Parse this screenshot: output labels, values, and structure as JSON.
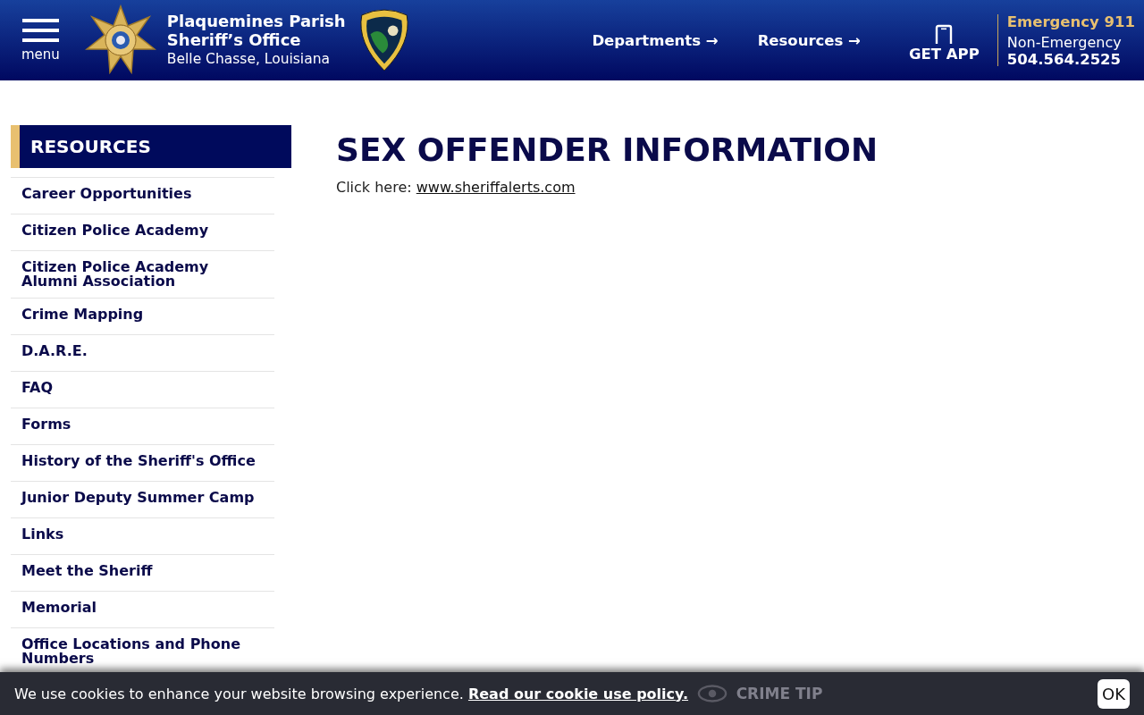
{
  "header": {
    "menu_label": "menu",
    "title_line1": "Plaquemines Parish",
    "title_line2": "Sheriff’s Office",
    "subtitle": "Belle Chasse, Louisiana",
    "nav": [
      {
        "label": "Departments",
        "arrow": "→"
      },
      {
        "label": "Resources",
        "arrow": "→"
      }
    ],
    "app_label": "GET APP",
    "emergency": "Emergency 911",
    "non_emergency_label": "Non-Emergency",
    "non_emergency_number": "504.564.2525"
  },
  "sidebar": {
    "heading": "RESOURCES",
    "items": [
      {
        "label": "Career Opportunities"
      },
      {
        "label": "Citizen Police Academy"
      },
      {
        "label": "Citizen Police Academy Alumni Association"
      },
      {
        "label": "Crime Mapping"
      },
      {
        "label": "D.A.R.E."
      },
      {
        "label": "FAQ"
      },
      {
        "label": "Forms"
      },
      {
        "label": "History of the Sheriff's Office"
      },
      {
        "label": "Junior Deputy Summer Camp"
      },
      {
        "label": "Links"
      },
      {
        "label": "Meet the Sheriff"
      },
      {
        "label": "Memorial"
      },
      {
        "label": "Office Locations and Phone Numbers"
      }
    ]
  },
  "main": {
    "title": "SEX OFFENDER INFORMATION",
    "lead": "Click here:",
    "link": "www.sheriffalerts.com"
  },
  "bottom_bar": {
    "crime_tip": "CRIME TIP"
  },
  "cookie_bar": {
    "text": "We use cookies to enhance your website browsing experience.",
    "link": "Read our cookie use policy.",
    "button": "OK"
  }
}
